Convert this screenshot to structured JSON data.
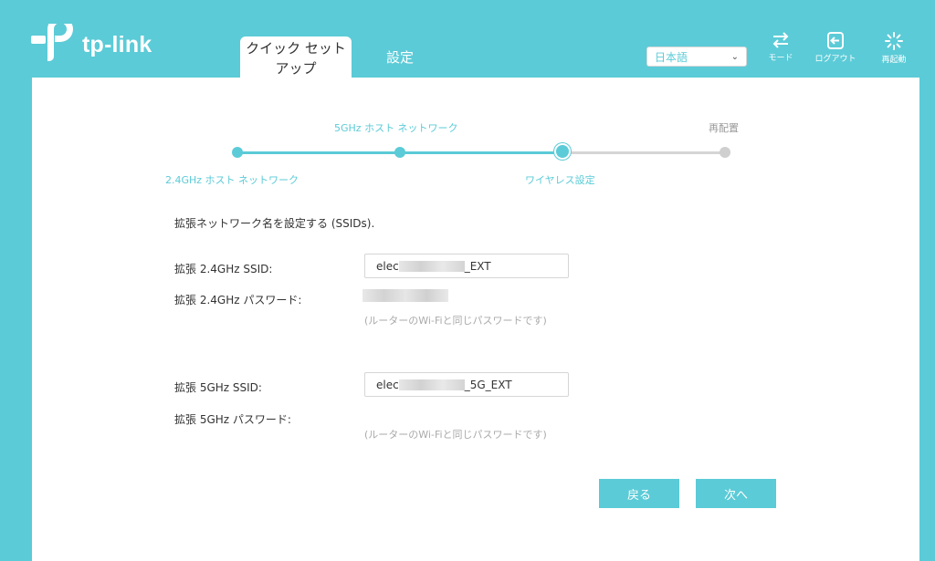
{
  "header": {
    "logo_text": "tp-link",
    "tabs": [
      {
        "label_line1": "クイック セット",
        "label_line2": "アップ"
      },
      {
        "label": "設定"
      }
    ],
    "language": "日本語",
    "buttons": {
      "mode": "モード",
      "logout": "ログアウト",
      "reboot": "再起動"
    }
  },
  "stepper": {
    "steps": [
      {
        "label": "2.4GHz ホスト ネットワーク",
        "state": "done"
      },
      {
        "label": "5GHz ホスト ネットワーク",
        "state": "done"
      },
      {
        "label": "ワイヤレス設定",
        "state": "current"
      },
      {
        "label": "再配置",
        "state": "todo"
      }
    ]
  },
  "form": {
    "intro": "拡張ネットワーク名を設定する (SSIDs).",
    "ssid_24_label": "拡張 2.4GHz SSID:",
    "ssid_24_prefix": "elec",
    "ssid_24_suffix": "_EXT",
    "pw_24_label": "拡張 2.4GHz パスワード:",
    "pw_24_hint": "(ルーターのWi-Fiと同じパスワードです)",
    "ssid_5_label": "拡張 5GHz SSID:",
    "ssid_5_prefix": "elec",
    "ssid_5_suffix": "_5G_EXT",
    "pw_5_label": "拡張 5GHz パスワード:",
    "pw_5_hint": "(ルーターのWi-Fiと同じパスワードです)"
  },
  "actions": {
    "back": "戻る",
    "next": "次へ"
  },
  "colors": {
    "accent": "#5bcbd7",
    "inactive": "#d5d5d5"
  }
}
